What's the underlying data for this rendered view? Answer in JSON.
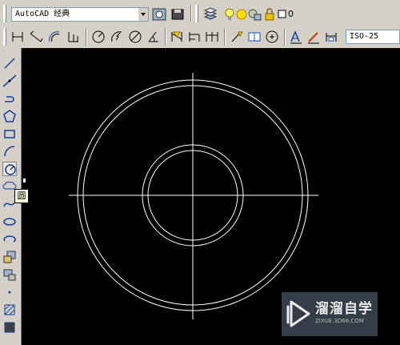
{
  "toolbar_top": {
    "workspace": "AutoCAD 经典",
    "layer_value": "0"
  },
  "toolbar_dim": {
    "dimstyle": "ISO-25"
  },
  "tooltip": {
    "text": "圆"
  },
  "watermark": {
    "brand": "溜溜自学",
    "url": "ZIXUE.3D66.COM"
  }
}
